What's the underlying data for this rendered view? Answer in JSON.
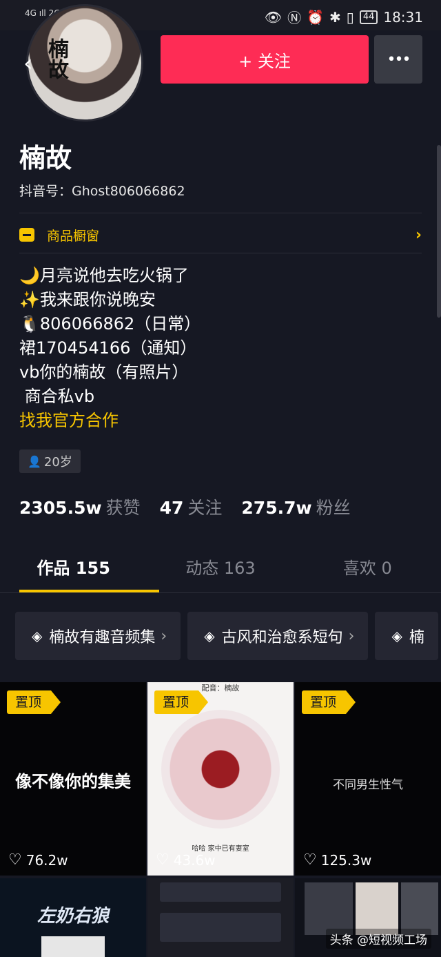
{
  "status_bar": {
    "signal1": "4G",
    "signal2": "2G",
    "time": "18:31",
    "battery": "44"
  },
  "header": {
    "follow_label": "+ 关注",
    "avatar_text": "楠故"
  },
  "profile": {
    "name": "楠故",
    "douyin_id": "抖音号：Ghost806066862",
    "shop_label": "商品橱窗",
    "bio_lines": [
      "🌙月亮说他去吃火锅了",
      "✨我来跟你说晚安",
      "🐧806066862（日常）",
      "裙170454166（通知）",
      "vb你的楠故（有照片）",
      " 商合私vb"
    ],
    "bio_link": "找我官方合作",
    "age": "20岁"
  },
  "stats": {
    "likes_value": "2305.5w",
    "likes_label": "获赞",
    "following_value": "47",
    "following_label": "关注",
    "fans_value": "275.7w",
    "fans_label": "粉丝"
  },
  "tabs": [
    {
      "label": "作品 155"
    },
    {
      "label": "动态 163"
    },
    {
      "label": "喜欢 0"
    }
  ],
  "collections": [
    {
      "label": "楠故有趣音频集"
    },
    {
      "label": "古风和治愈系短句"
    },
    {
      "label": "楠"
    }
  ],
  "videos": [
    {
      "pinned": "置顶",
      "caption": "像不像你的集美",
      "likes": "76.2w"
    },
    {
      "pinned": "置顶",
      "top_text": "配音：楠故",
      "bottom_text": "哈哈 家中已有妻室",
      "likes": "43.6w"
    },
    {
      "pinned": "置顶",
      "caption": "不同男生性气",
      "likes": "125.3w"
    },
    {
      "caption": "左奶右狼"
    },
    {
      "caption": ""
    },
    {
      "caption": ""
    }
  ],
  "watermark": "头条 @短视频工场",
  "colors": {
    "accent": "#fe2c55",
    "highlight": "#f7c500",
    "bg": "#161823"
  }
}
